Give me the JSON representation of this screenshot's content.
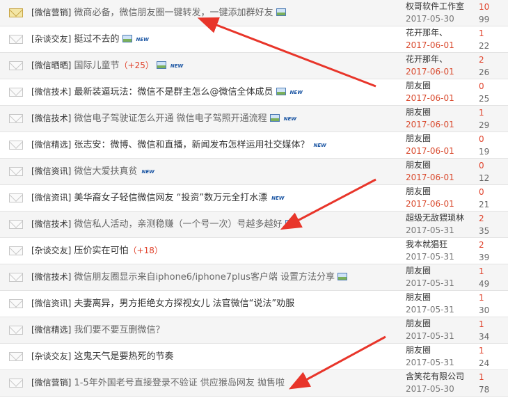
{
  "threads": [
    {
      "category": "[微信营销]",
      "title": "微商必备，微信朋友圈一键转发，一键添加群好友",
      "plus": "",
      "has_image": true,
      "is_new": false,
      "hot": true,
      "author": "权哥软件工作室",
      "date": "2017-05-30",
      "date_red": false,
      "replies": "10",
      "views": "99"
    },
    {
      "category": "[杂谈交友]",
      "title": "挺过不去的",
      "plus": "",
      "has_image": true,
      "is_new": true,
      "hot": false,
      "author": "花开那年、",
      "date": "2017-06-01",
      "date_red": true,
      "replies": "1",
      "views": "22"
    },
    {
      "category": "[微信晒晒]",
      "title": "国际儿童节",
      "plus": "（+25）",
      "has_image": true,
      "is_new": true,
      "hot": false,
      "author": "花开那年、",
      "date": "2017-06-01",
      "date_red": true,
      "replies": "2",
      "views": "26"
    },
    {
      "category": "[微信技术]",
      "title": "最新装逼玩法：微信不是群主怎么@微信全体成员",
      "plus": "",
      "has_image": true,
      "is_new": true,
      "hot": false,
      "author": "朋友圈",
      "date": "2017-06-01",
      "date_red": true,
      "replies": "0",
      "views": "25"
    },
    {
      "category": "[微信技术]",
      "title": "微信电子驾驶证怎么开通 微信电子驾照开通流程",
      "plus": "",
      "has_image": true,
      "is_new": true,
      "hot": false,
      "author": "朋友圈",
      "date": "2017-06-01",
      "date_red": true,
      "replies": "1",
      "views": "29"
    },
    {
      "category": "[微信精选]",
      "title": "张志安：微博、微信和直播，新闻发布怎样运用社交媒体？",
      "plus": "",
      "has_image": false,
      "is_new": true,
      "hot": false,
      "author": "朋友圈",
      "date": "2017-06-01",
      "date_red": true,
      "replies": "0",
      "views": "19"
    },
    {
      "category": "[微信资讯]",
      "title": "微信大爱扶真贫",
      "plus": "",
      "has_image": false,
      "is_new": true,
      "hot": false,
      "author": "朋友圈",
      "date": "2017-06-01",
      "date_red": true,
      "replies": "0",
      "views": "12"
    },
    {
      "category": "[微信资讯]",
      "title": "美华裔女子轻信微信网友 “投资”数万元全打水漂",
      "plus": "",
      "has_image": false,
      "is_new": true,
      "hot": false,
      "author": "朋友圈",
      "date": "2017-06-01",
      "date_red": true,
      "replies": "0",
      "views": "21"
    },
    {
      "category": "[微信技术]",
      "title": "微信私人活动，亲测稳赚（一个号一次）号越多越好",
      "plus": "",
      "has_image": true,
      "is_new": false,
      "hot": false,
      "author": "超级无敌猥琐林",
      "date": "2017-05-31",
      "date_red": false,
      "replies": "2",
      "views": "35"
    },
    {
      "category": "[杂谈交友]",
      "title": "压价实在可怕",
      "plus": "（+18）",
      "has_image": false,
      "is_new": false,
      "hot": false,
      "author": "我本就猖狂",
      "date": "2017-05-31",
      "date_red": false,
      "replies": "2",
      "views": "39"
    },
    {
      "category": "[微信技术]",
      "title": "微信朋友圈显示来自iphone6/iphone7plus客户端 设置方法分享",
      "plus": "",
      "has_image": true,
      "is_new": false,
      "hot": false,
      "author": "朋友圈",
      "date": "2017-05-31",
      "date_red": false,
      "replies": "1",
      "views": "49"
    },
    {
      "category": "[微信资讯]",
      "title": "夫妻离异，男方拒绝女方探视女儿 法官微信“说法”劝服",
      "plus": "",
      "has_image": false,
      "is_new": false,
      "hot": false,
      "author": "朋友圈",
      "date": "2017-05-31",
      "date_red": false,
      "replies": "1",
      "views": "30"
    },
    {
      "category": "[微信精选]",
      "title": "我们要不要互删微信？",
      "plus": "",
      "has_image": false,
      "is_new": false,
      "hot": false,
      "author": "朋友圈",
      "date": "2017-05-31",
      "date_red": false,
      "replies": "1",
      "views": "34"
    },
    {
      "category": "[杂谈交友]",
      "title": "这鬼天气是要热死的节奏",
      "plus": "",
      "has_image": false,
      "is_new": false,
      "hot": false,
      "author": "朋友圈",
      "date": "2017-05-31",
      "date_red": false,
      "replies": "1",
      "views": "24"
    },
    {
      "category": "[微信营销]",
      "title": "1-5年外国老号直接登录不验证  供应猴岛网友  抛售啦",
      "plus": "",
      "has_image": false,
      "is_new": false,
      "hot": false,
      "author": "含笑花有限公司",
      "date": "2017-05-30",
      "date_red": false,
      "replies": "1",
      "views": "78"
    }
  ],
  "new_label": "NEW",
  "colors": {
    "accent_red": "#e0412a",
    "arrow_red": "#e8352a",
    "link_blue": "#1a55a3"
  }
}
